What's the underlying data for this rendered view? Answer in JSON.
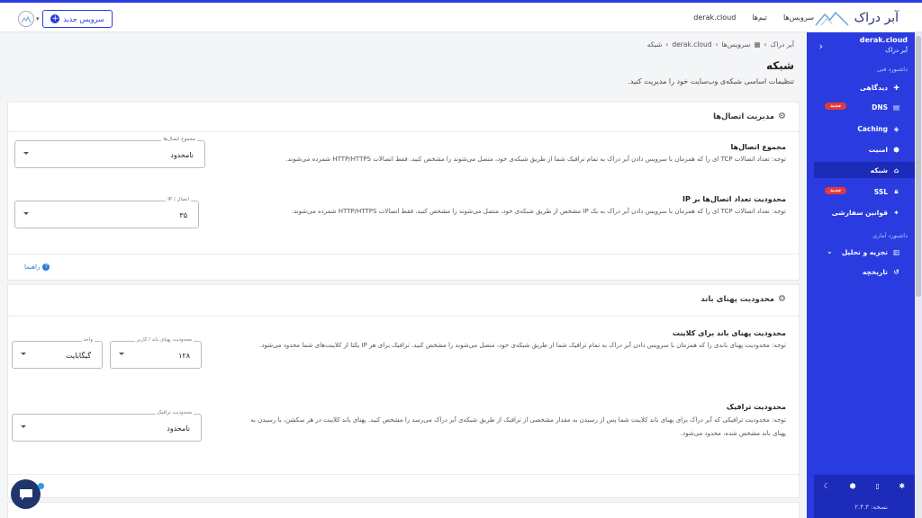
{
  "topbar": {
    "brand": "آبر دراک",
    "nav": [
      "سرویس‌ها",
      "تیم‌ها",
      "derak.cloud"
    ],
    "new_service": "سرویس جدید"
  },
  "sidebar": {
    "domain": "derak.cloud",
    "org": "آبر دراک",
    "section_tech": "داشبورد فنی",
    "section_stats": "داشبورد آماری",
    "items": [
      {
        "label": "دیدگاهی",
        "icon": "puzzle-icon"
      },
      {
        "label": "DNS",
        "icon": "server-icon",
        "badge": "جدید"
      },
      {
        "label": "Caching",
        "icon": "layers-icon"
      },
      {
        "label": "امنیت",
        "icon": "shield-icon"
      },
      {
        "label": "شبکه",
        "icon": "network-icon",
        "active": true
      },
      {
        "label": "SSL",
        "icon": "lock-icon",
        "badge": "جدید"
      },
      {
        "label": "قوانین سفارشی",
        "icon": "wand-icon"
      }
    ],
    "stats_items": [
      {
        "label": "تجزیه و تحلیل",
        "icon": "chart-icon"
      },
      {
        "label": "تاریخچه",
        "icon": "history-icon"
      }
    ],
    "version": "نسخه: ۲.۴.۳"
  },
  "breadcrumb": [
    "آبر دراک",
    "سرویس‌ها",
    "derak.cloud",
    "شبکه"
  ],
  "page": {
    "title": "شبکه",
    "description": "تنظیمات اساسی شبکه‌ی وب‌سایت خود را مدیریت کنید."
  },
  "connections_card": {
    "title": "مدیریت اتصال‌ها",
    "total": {
      "title": "مجموع اتصال‌ها",
      "desc": "توجه: تعداد اتصالات TCP ای را که همزمان با سرویس دادن آبر دراک به تمام ترافیک شما از طریق شبکه‌ی خود، متصل می‌شوند را مشخص کنید. فقط اتصالات HTTP/HTTPS شمرده می‌شوند.",
      "field_label": "مجموع اتصال‌ها",
      "field_value": "نامحدود"
    },
    "per_ip": {
      "title": "محدودیت تعداد اتصال‌ها بر IP",
      "desc": "توجه: تعداد اتصالات TCP ای را که همزمان با سرویس دادن آبر دراک به یک IP مشخص از طریق شبکه‌ی خود، متصل می‌شوند را مشخص کنید. فقط اتصالات HTTP/HTTPS شمرده می‌شوند.",
      "field_label": "اتصال / IP",
      "field_value": "۳۵"
    },
    "help": "راهنما"
  },
  "bandwidth_card": {
    "title": "محدودیت پهنای باند",
    "client": {
      "title": "محدودیت پهنای باند برای کلاینت",
      "desc": "توجه: محدودیت پهنای باندی را که همزمان با سرویس دادن آبر دراک به تمام ترافیک شما از طریق شبکه‌ی خود، متصل می‌شوند را مشخص کنید. ترافیک برای هر IP یکتا از کلاینت‌های شما محدود می‌شود.",
      "field_label": "محدودیت پهنای باند / کاربر",
      "field_value": "۱۲۸",
      "unit_label": "واحد",
      "unit_value": "گیگابایت"
    },
    "traffic": {
      "title": "محدودیت ترافیک",
      "desc_line1": "توجه: محدودیت ترافیکی که آبر دراک برای پهنای باند کلاینت شما پس از رسیدن به مقدار مشخصی از ترافیک از طریق شبکه‌ی آبر دراک می‌رسد را مشخص کنید. پهنای باند کلاینت در هر سکشن، با رسیدن به",
      "desc_line2": "پهنای باند مشخص شده، محدود می‌شود.",
      "field_label": "محدودیت ترافیک",
      "field_value": "نامحدود"
    }
  },
  "colors": {
    "primary": "#2a3ce0",
    "badge": "#e5383b",
    "chat": "#20356b"
  }
}
